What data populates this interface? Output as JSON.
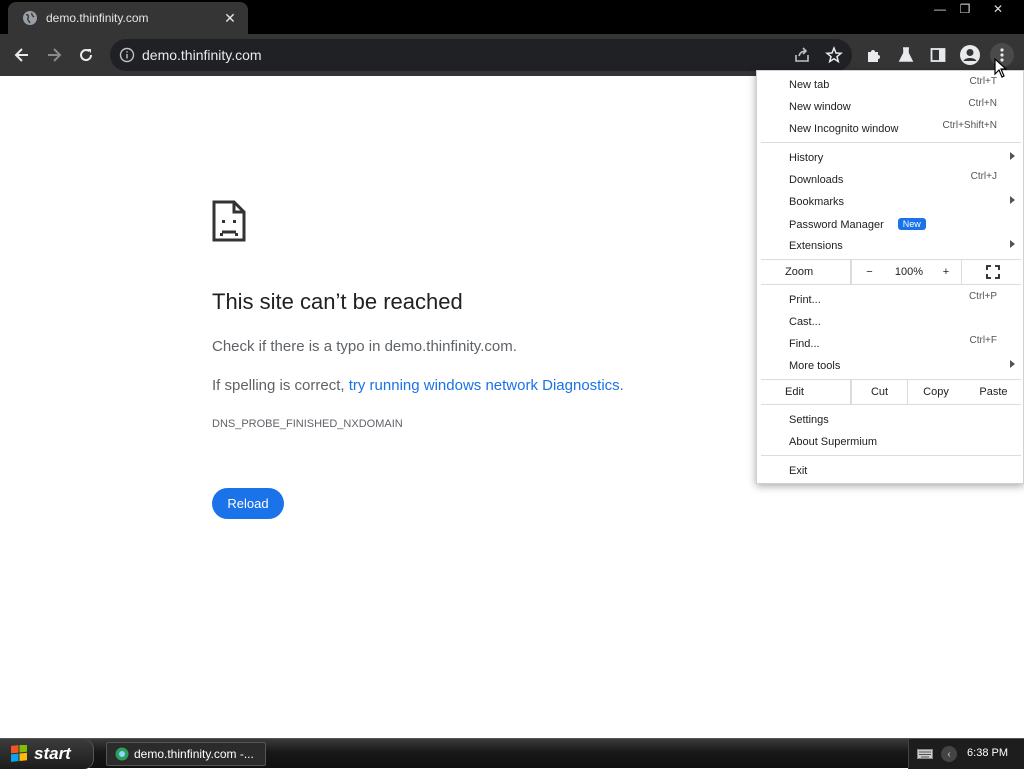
{
  "tab": {
    "title": "demo.thinfinity.com",
    "close_glyph": "✕"
  },
  "window_controls": {
    "minimize": "—",
    "restore": "❐",
    "close": "✕"
  },
  "toolbar": {
    "url": "demo.thinfinity.com"
  },
  "error": {
    "title": "This site can’t be reached",
    "typo_text": "Check if there is a typo in demo.thinfinity.com.",
    "spelling_prefix": "If spelling is correct, ",
    "diagnostics_link": "try running windows network Diagnostics",
    "spelling_suffix": ".",
    "code": "DNS_PROBE_FINISHED_NXDOMAIN",
    "reload_label": "Reload"
  },
  "menu": {
    "new_tab": {
      "label": "New tab",
      "shortcut": "Ctrl+T"
    },
    "new_window": {
      "label": "New window",
      "shortcut": "Ctrl+N"
    },
    "new_incognito": {
      "label": "New Incognito window",
      "shortcut": "Ctrl+Shift+N"
    },
    "history": {
      "label": "History"
    },
    "downloads": {
      "label": "Downloads",
      "shortcut": "Ctrl+J"
    },
    "bookmarks": {
      "label": "Bookmarks"
    },
    "password_manager": {
      "label": "Password Manager",
      "badge": "New"
    },
    "extensions": {
      "label": "Extensions"
    },
    "zoom": {
      "label": "Zoom",
      "minus": "−",
      "level": "100%",
      "plus": "+"
    },
    "print": {
      "label": "Print...",
      "shortcut": "Ctrl+P"
    },
    "cast": {
      "label": "Cast..."
    },
    "find": {
      "label": "Find...",
      "shortcut": "Ctrl+F"
    },
    "more_tools": {
      "label": "More tools"
    },
    "edit": {
      "label": "Edit",
      "cut": "Cut",
      "copy": "Copy",
      "paste": "Paste"
    },
    "settings": {
      "label": "Settings"
    },
    "about": {
      "label": "About Supermium"
    },
    "exit": {
      "label": "Exit"
    }
  },
  "taskbar": {
    "start_label": "start",
    "task_label": "demo.thinfinity.com -...",
    "clock": "6:38 PM"
  },
  "colors": {
    "accent": "#1a73e8",
    "toolbar": "#353535",
    "titlebar": "#000000"
  }
}
